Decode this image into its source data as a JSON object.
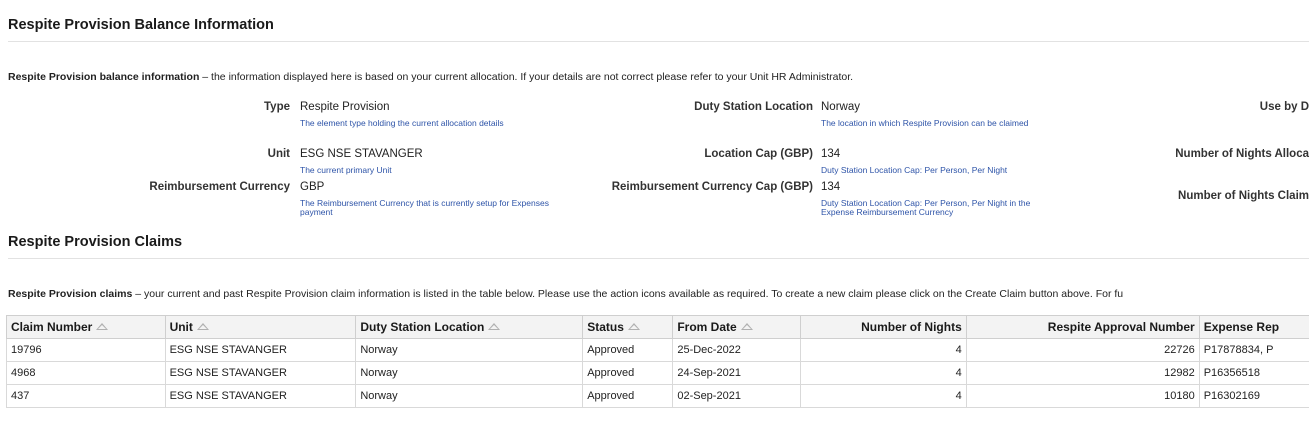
{
  "balance": {
    "title": "Respite Provision Balance Information",
    "intro_bold": "Respite Provision balance information",
    "intro_text": " – the information displayed here is based on your current allocation. If your details are not correct please refer to your Unit HR Administrator.",
    "fields": {
      "type": {
        "label": "Type",
        "value": "Respite Provision",
        "help": "The element type holding the current allocation details"
      },
      "unit": {
        "label": "Unit",
        "value": "ESG NSE STAVANGER",
        "help": "The current primary Unit"
      },
      "reimb_currency": {
        "label": "Reimbursement Currency",
        "value": "GBP",
        "help": "The Reimbursement Currency that is currently setup for Expenses payment"
      },
      "duty_station": {
        "label": "Duty Station Location",
        "value": "Norway",
        "help": "The location in which Respite Provision can be claimed"
      },
      "location_cap": {
        "label": "Location Cap (GBP)",
        "value": "134",
        "help": "Duty Station Location Cap: Per Person, Per Night"
      },
      "reimb_currency_cap": {
        "label": "Reimbursement Currency Cap (GBP)",
        "value": "134",
        "help": "Duty Station Location Cap: Per Person, Per Night in the Expense Reimbursement Currency"
      },
      "use_by": {
        "label": "Use by D"
      },
      "nights_allocated": {
        "label": "Number of Nights Alloca"
      },
      "nights_claimed": {
        "label": "Number of Nights Claim"
      }
    }
  },
  "claims": {
    "title": "Respite Provision Claims",
    "intro_bold": "Respite Provision claims",
    "intro_text": " – your current and past Respite Provision claim information is listed in the table below. Please use the action icons available as required. To create a new claim please click on the Create Claim button above. For fu",
    "columns": [
      "Claim Number",
      "Unit",
      "Duty Station Location",
      "Status",
      "From Date",
      "Number of Nights",
      "Respite Approval Number",
      "Expense Rep"
    ],
    "rows": [
      [
        "19796",
        "ESG NSE STAVANGER",
        "Norway",
        "Approved",
        "25-Dec-2022",
        "4",
        "22726",
        "P17878834, P"
      ],
      [
        "4968",
        "ESG NSE STAVANGER",
        "Norway",
        "Approved",
        "24-Sep-2021",
        "4",
        "12982",
        "P16356518"
      ],
      [
        "437",
        "ESG NSE STAVANGER",
        "Norway",
        "Approved",
        "02-Sep-2021",
        "4",
        "10180",
        "P16302169"
      ]
    ]
  }
}
